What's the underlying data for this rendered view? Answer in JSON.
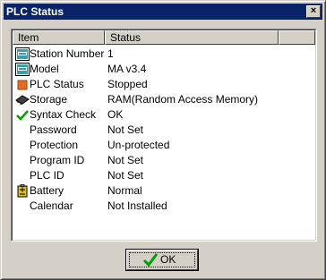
{
  "window": {
    "title": "PLC Status",
    "close_glyph": "×"
  },
  "list": {
    "columns": [
      "Item",
      "Status"
    ],
    "rows": [
      {
        "item": "Station Number",
        "status": "1",
        "icon": "station-icon"
      },
      {
        "item": "Model",
        "status": "MA v3.4",
        "icon": "model-icon"
      },
      {
        "item": "PLC Status",
        "status": "Stopped",
        "icon": "stopped-icon"
      },
      {
        "item": "Storage",
        "status": "RAM(Random Access Memory)",
        "icon": "ram-chip-icon"
      },
      {
        "item": "Syntax Check",
        "status": "OK",
        "icon": "checkmark-icon"
      },
      {
        "item": "Password",
        "status": "Not Set",
        "icon": ""
      },
      {
        "item": "Protection",
        "status": "Un-protected",
        "icon": ""
      },
      {
        "item": "Program ID",
        "status": "Not Set",
        "icon": ""
      },
      {
        "item": "PLC ID",
        "status": "Not Set",
        "icon": ""
      },
      {
        "item": "Battery",
        "status": "Normal",
        "icon": "battery-icon"
      },
      {
        "item": "Calendar",
        "status": "Not Installed",
        "icon": ""
      }
    ]
  },
  "buttons": {
    "ok_label": "OK"
  },
  "colors": {
    "titlebar": "#0a246a",
    "face": "#d4d0c8",
    "stopped": "#e07020",
    "check": "#00a000"
  }
}
